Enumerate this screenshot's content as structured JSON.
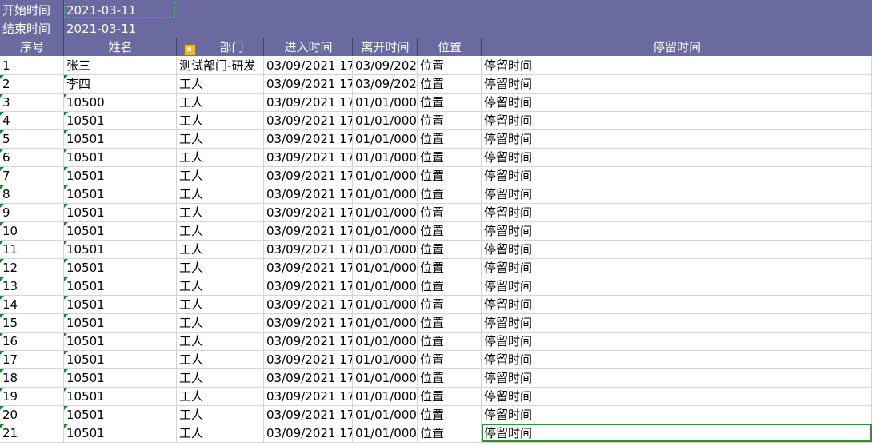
{
  "header": {
    "start_label": "开始时间",
    "start_value": "2021-03-11",
    "end_label": "结束时间",
    "end_value": "2021-03-11"
  },
  "columns": [
    "序号",
    "姓名",
    "部门",
    "进入时间",
    "离开时间",
    "位置",
    "停留时间"
  ],
  "rows": [
    [
      "1",
      "张三",
      "测试部门-研发",
      "03/09/2021 17",
      "03/09/202",
      "位置",
      "停留时间"
    ],
    [
      "2",
      "李四",
      "工人",
      "03/09/2021 17",
      "03/09/202",
      "位置",
      "停留时间"
    ],
    [
      "3",
      "10500",
      "工人",
      "03/09/2021 17",
      "01/01/000",
      "位置",
      "停留时间"
    ],
    [
      "4",
      "10501",
      "工人",
      "03/09/2021 17",
      "01/01/000",
      "位置",
      "停留时间"
    ],
    [
      "5",
      "10501",
      "工人",
      "03/09/2021 17",
      "01/01/000",
      "位置",
      "停留时间"
    ],
    [
      "6",
      "10501",
      "工人",
      "03/09/2021 17",
      "01/01/000",
      "位置",
      "停留时间"
    ],
    [
      "7",
      "10501",
      "工人",
      "03/09/2021 17",
      "01/01/000",
      "位置",
      "停留时间"
    ],
    [
      "8",
      "10501",
      "工人",
      "03/09/2021 17",
      "01/01/000",
      "位置",
      "停留时间"
    ],
    [
      "9",
      "10501",
      "工人",
      "03/09/2021 17",
      "01/01/000",
      "位置",
      "停留时间"
    ],
    [
      "10",
      "10501",
      "工人",
      "03/09/2021 17",
      "01/01/000",
      "位置",
      "停留时间"
    ],
    [
      "11",
      "10501",
      "工人",
      "03/09/2021 17",
      "01/01/000",
      "位置",
      "停留时间"
    ],
    [
      "12",
      "10501",
      "工人",
      "03/09/2021 17",
      "01/01/000",
      "位置",
      "停留时间"
    ],
    [
      "13",
      "10501",
      "工人",
      "03/09/2021 17",
      "01/01/000",
      "位置",
      "停留时间"
    ],
    [
      "14",
      "10501",
      "工人",
      "03/09/2021 17",
      "01/01/000",
      "位置",
      "停留时间"
    ],
    [
      "15",
      "10501",
      "工人",
      "03/09/2021 17",
      "01/01/000",
      "位置",
      "停留时间"
    ],
    [
      "16",
      "10501",
      "工人",
      "03/09/2021 17",
      "01/01/000",
      "位置",
      "停留时间"
    ],
    [
      "17",
      "10501",
      "工人",
      "03/09/2021 17",
      "01/01/000",
      "位置",
      "停留时间"
    ],
    [
      "18",
      "10501",
      "工人",
      "03/09/2021 17",
      "01/01/000",
      "位置",
      "停留时间"
    ],
    [
      "19",
      "10501",
      "工人",
      "03/09/2021 17",
      "01/01/000",
      "位置",
      "停留时间"
    ],
    [
      "20",
      "10501",
      "工人",
      "03/09/2021 17",
      "01/01/000",
      "位置",
      "停留时间"
    ],
    [
      "21",
      "10501",
      "工人",
      "03/09/2021 17",
      "01/01/000",
      "位置",
      "停留时间"
    ]
  ],
  "selected_row": 21,
  "colors": {
    "header_band": "#6a6aa0",
    "grid_line": "#d4d4d4",
    "selection": "#2f8f3d",
    "marquee": "#3bbf59"
  },
  "icons": {
    "dept_header": "clipboard-icon"
  }
}
